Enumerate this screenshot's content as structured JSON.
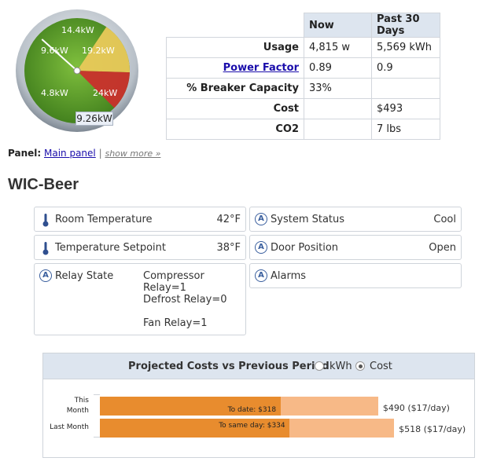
{
  "gauge": {
    "labels": [
      "14.4kW",
      "9.6kW",
      "19.2kW",
      "4.8kW",
      "24kW"
    ],
    "current_readout": "9.26kW",
    "current_value_kw": 9.26,
    "max_kw": 28.8,
    "colors": {
      "green": "#6aa52e",
      "yellow": "#e9c95a",
      "red": "#c9302c",
      "bezel": "#9aa3ad"
    }
  },
  "usage_table": {
    "headers": [
      "Now",
      "Past 30 Days"
    ],
    "rows": [
      {
        "label": "Usage",
        "now": "4,815 w",
        "past": "5,569 kWh",
        "link": false
      },
      {
        "label": "Power Factor",
        "now": "0.89",
        "past": "0.9",
        "link": true
      },
      {
        "label": "% Breaker Capacity",
        "now": "33%",
        "past": "",
        "link": false
      },
      {
        "label": "Cost",
        "now": "",
        "past": "$493",
        "link": false
      },
      {
        "label": "CO2",
        "now": "",
        "past": "7 lbs",
        "link": false
      }
    ]
  },
  "panel": {
    "label": "Panel:",
    "link_text": "Main panel",
    "separator": "|",
    "show_more": "show more »"
  },
  "section_title": "WIC-Beer",
  "cards": {
    "room_temp": {
      "label": "Room Temperature",
      "value": "42°F"
    },
    "setpoint": {
      "label": "Temperature Setpoint",
      "value": "38°F"
    },
    "system_status": {
      "label": "System Status",
      "value": "Cool"
    },
    "door_position": {
      "label": "Door Position",
      "value": "Open"
    },
    "relay_state": {
      "label": "Relay State",
      "values": [
        "Compressor Relay=1",
        "Defrost Relay=0",
        "Fan Relay=1"
      ]
    },
    "alarms": {
      "label": "Alarms"
    },
    "icon_letter": "A"
  },
  "projection": {
    "title": "Projected Costs vs Previous Period",
    "options": [
      "kWh",
      "Cost"
    ],
    "selected": "Cost",
    "rows": [
      {
        "label_line1": "This",
        "label_line2": "Month",
        "to_date_text": "To date: $318",
        "to_date": 318,
        "total": 490,
        "total_text": "$490 ($17/day)"
      },
      {
        "label_line1": "Last Month",
        "label_line2": "",
        "to_date_text": "To same day: $334",
        "to_date": 334,
        "total": 518,
        "total_text": "$518 ($17/day)"
      }
    ],
    "colors": {
      "bar_part": "#e88c2e",
      "bar_full": "#f7b987"
    }
  }
}
